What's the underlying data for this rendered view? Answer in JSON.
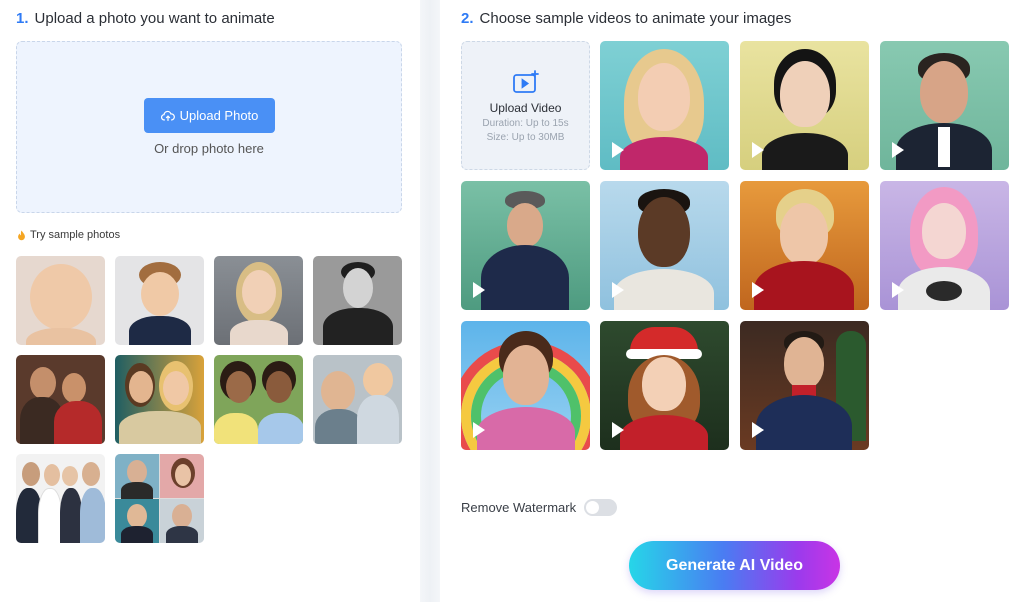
{
  "left": {
    "step_number": "1.",
    "step_title": "Upload a photo you want to animate",
    "upload_button_label": "Upload Photo",
    "drop_text": "Or drop photo here",
    "sample_label": "Try sample photos",
    "sample_photos": [
      {
        "name": "baby"
      },
      {
        "name": "boy"
      },
      {
        "name": "woman-blonde"
      },
      {
        "name": "man-bw"
      },
      {
        "name": "couple"
      },
      {
        "name": "two-women"
      },
      {
        "name": "two-kids"
      },
      {
        "name": "grandpa-child"
      },
      {
        "name": "group-four"
      },
      {
        "name": "collage-four"
      }
    ]
  },
  "right": {
    "step_number": "2.",
    "step_title": "Choose sample videos to animate your images",
    "upload_video": {
      "title": "Upload Video",
      "duration": "Duration: Up to 15s",
      "size": "Size: Up to 30MB"
    },
    "watermark_label": "Remove Watermark",
    "watermark_enabled": false,
    "generate_button_label": "Generate AI Video"
  },
  "colors": {
    "accent": "#2f7bf5",
    "upload_button": "#4a90f5",
    "upload_area_bg": "#eef4fe"
  }
}
